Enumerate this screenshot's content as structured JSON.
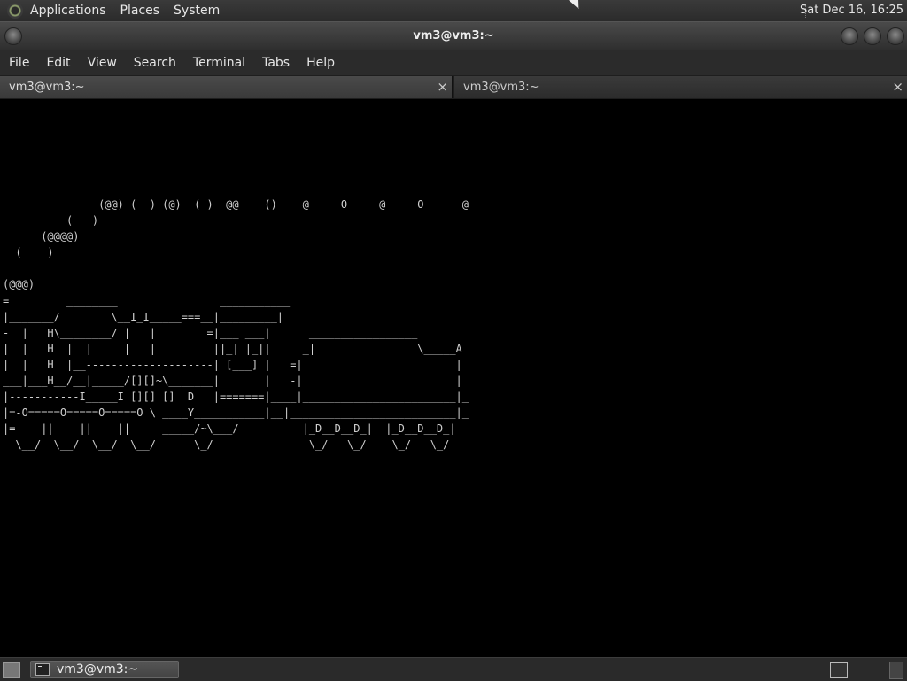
{
  "top_panel": {
    "menus": [
      "Applications",
      "Places",
      "System"
    ],
    "clock": "Sat Dec 16, 16:25"
  },
  "window": {
    "title": "vm3@vm3:~"
  },
  "menubar": {
    "items": [
      "File",
      "Edit",
      "View",
      "Search",
      "Terminal",
      "Tabs",
      "Help"
    ]
  },
  "tabs": [
    {
      "label": "vm3@vm3:~",
      "close": "×"
    },
    {
      "label": "vm3@vm3:~",
      "close": "×"
    }
  ],
  "terminal": {
    "output": "               (@@) (  ) (@)  ( )  @@    ()    @     O     @     O      @\n          (   )\n      (@@@@)\n  (    )\n\n(@@@)\n=         ________                ___________\n|_______/        \\__I_I_____===__|_________|\n-  |   H\\________/ |   |        =|___ ___|      _________________\n|  |   H  |  |     |   |         ||_| |_||     _|                \\_____A\n|  |   H  |__--------------------| [___] |   =|                        |\n___|___H__/__|_____/[][]~\\_______|       |   -|                        |\n|-----------I_____I [][] []  D   |=======|____|________________________|_\n|=-O=====O=====O=====O \\ ____Y___________|__|__________________________|_\n|=    ||    ||    ||    |_____/~\\___/          |_D__D__D_|  |_D__D__D_|\n  \\__/  \\__/  \\__/  \\__/      \\_/               \\_/   \\_/    \\_/   \\_/"
  },
  "taskbar": {
    "task_label": "vm3@vm3:~"
  },
  "icons": {
    "panel_logo": "gnome-foot-icon",
    "show_desktop": "show-desktop-icon",
    "task_icon": "terminal-icon",
    "tray": "terminal-tray-icon",
    "trash": "trash-icon"
  }
}
